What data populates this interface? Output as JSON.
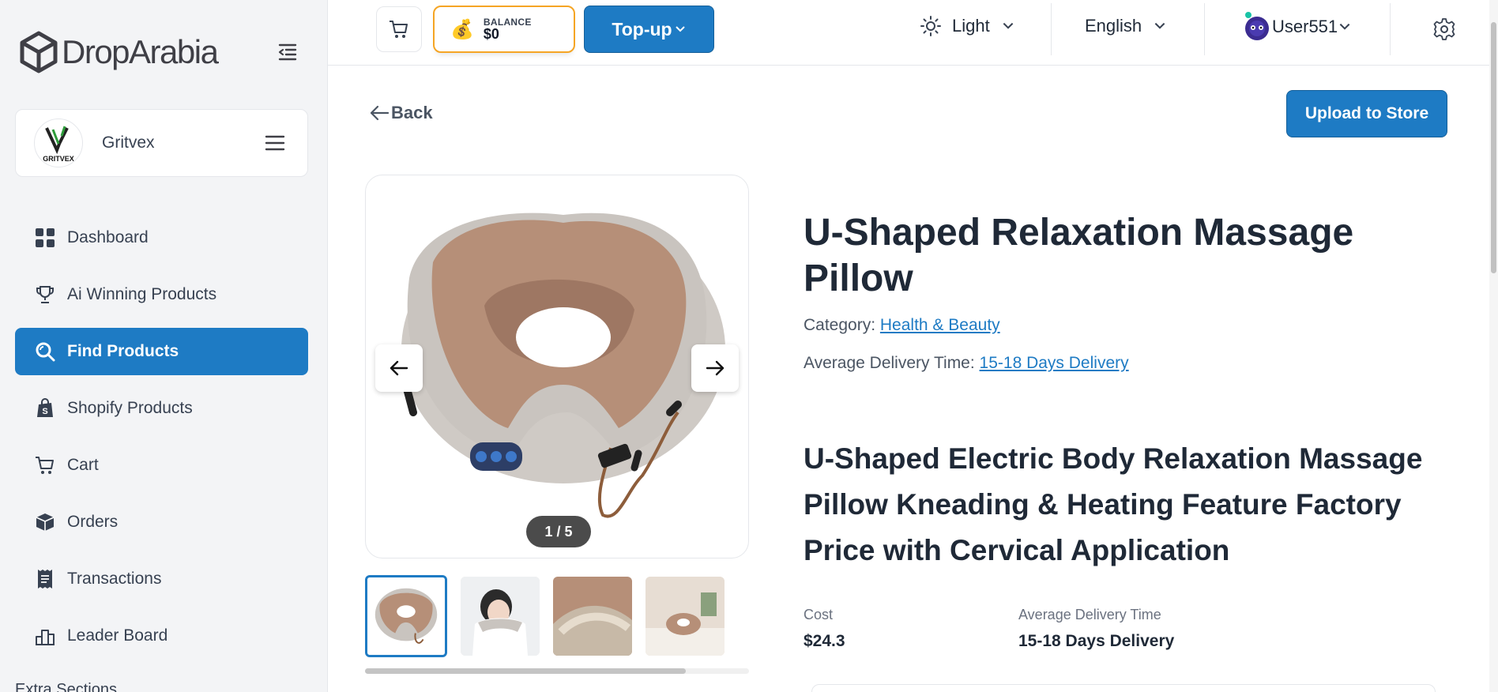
{
  "brand": {
    "name": "DropArabia"
  },
  "store": {
    "name": "Gritvex",
    "avatar_text": "GRITVEX"
  },
  "sidebar": {
    "items": [
      {
        "label": "Dashboard",
        "icon": "grid-icon"
      },
      {
        "label": "Ai Winning Products",
        "icon": "trophy-icon"
      },
      {
        "label": "Find Products",
        "icon": "search-icon",
        "active": true
      },
      {
        "label": "Shopify Products",
        "icon": "shopify-bag-icon"
      },
      {
        "label": "Cart",
        "icon": "cart-icon"
      },
      {
        "label": "Orders",
        "icon": "box-icon"
      },
      {
        "label": "Transactions",
        "icon": "receipt-icon"
      },
      {
        "label": "Leader Board",
        "icon": "leaderboard-icon"
      }
    ],
    "extra_label": "Extra Sections"
  },
  "header": {
    "balance_label": "BALANCE",
    "balance_amount": "$0",
    "topup_label": "Top-up",
    "theme_label": "Light",
    "language_label": "English",
    "user_label": "User551"
  },
  "main": {
    "back_label": "Back",
    "upload_label": "Upload to Store",
    "product_title": "U-Shaped Relaxation Massage Pillow",
    "category_label": "Category:",
    "category_value": "Health & Beauty",
    "delivery_label": "Average Delivery Time:",
    "delivery_value": "15-18 Days Delivery",
    "description": "U-Shaped Electric Body Relaxation Massage Pillow Kneading & Heating Feature Factory Price with Cervical Application",
    "image_counter": "1 / 5",
    "cost_label": "Cost",
    "cost_value": "$24.3",
    "avg_delivery_label": "Average Delivery Time",
    "avg_delivery_value": "15-18 Days Delivery"
  },
  "colors": {
    "accent": "#1e7bc4",
    "balance_border": "#f5a524",
    "sidebar_bg": "#f3f4f6"
  }
}
